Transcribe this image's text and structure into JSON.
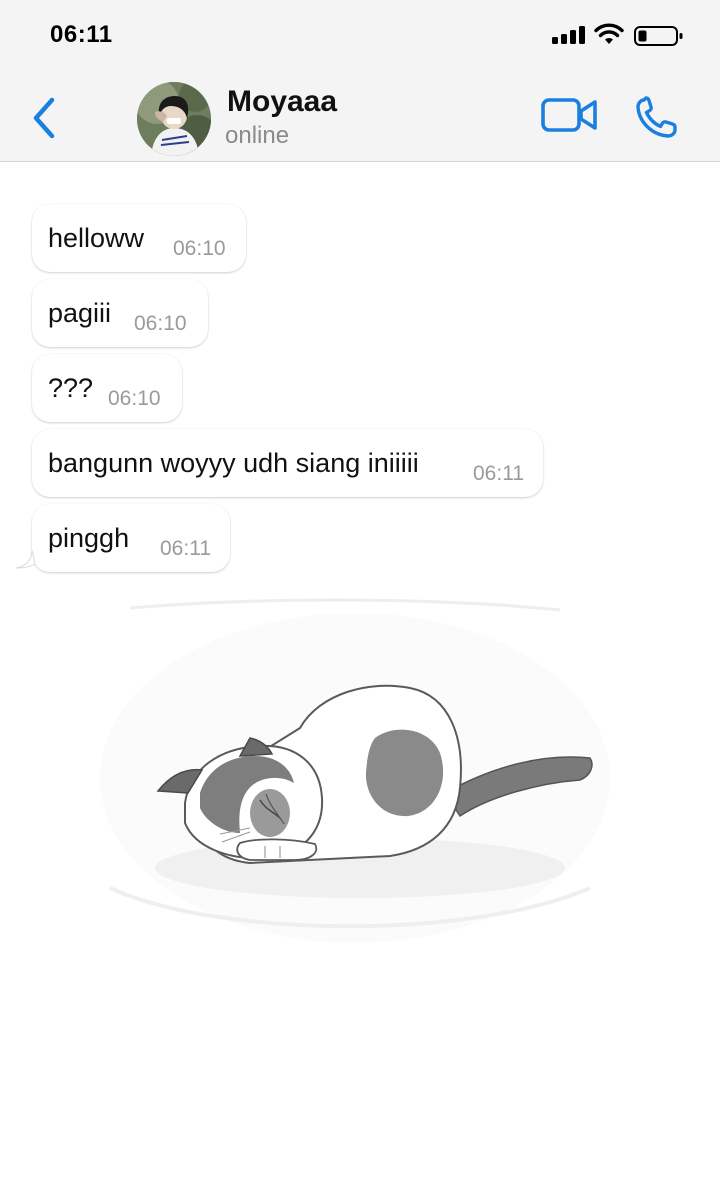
{
  "status_bar": {
    "time": "06:11"
  },
  "header": {
    "contact_name": "Moyaaa",
    "contact_status": "online"
  },
  "colors": {
    "accent": "#1a7fe0",
    "header_bg": "#f4f4f4",
    "timestamp": "#9a9a9a"
  },
  "icons": [
    "back-chevron-icon",
    "video-call-icon",
    "phone-icon",
    "signal-icon",
    "wifi-icon",
    "battery-icon"
  ],
  "messages": [
    {
      "text": "helloww",
      "time": "06:10"
    },
    {
      "text": "pagiii",
      "time": "06:10"
    },
    {
      "text": "???",
      "time": "06:10"
    },
    {
      "text": "bangunn woyyy udh siang iniiiii",
      "time": "06:11"
    },
    {
      "text": "pinggh",
      "time": "06:11"
    }
  ],
  "sticker": {
    "subject": "sleeping cat"
  }
}
